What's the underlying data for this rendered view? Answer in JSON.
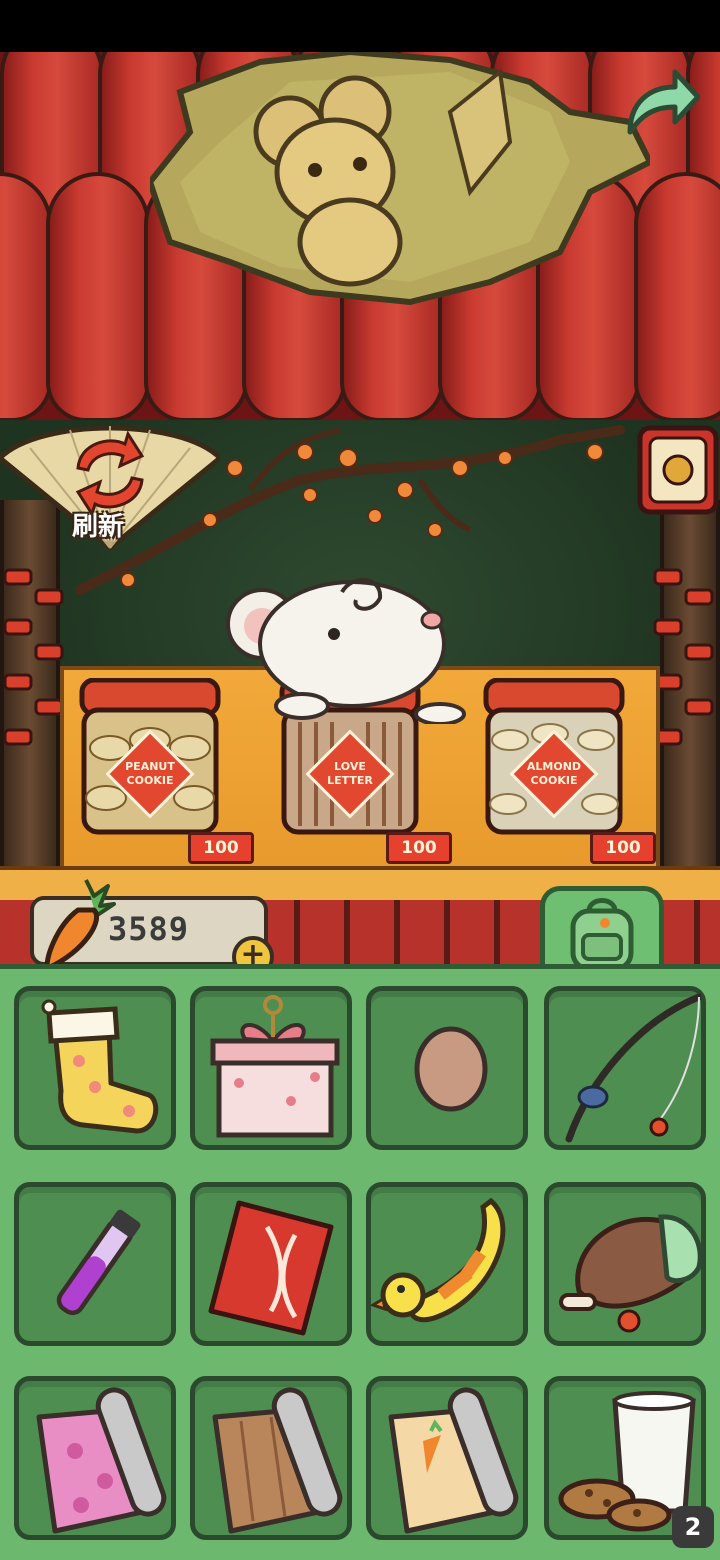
{
  "shop": {
    "refresh_label": "刷新",
    "goods": [
      {
        "name": "PEANUT COOKIE",
        "line1": "PEANUT",
        "line2": "COOKIE",
        "price": "100",
        "jar_color": "#d8c28a"
      },
      {
        "name": "LOVE LETTER",
        "line1": "LOVE",
        "line2": "LETTER",
        "price": "100",
        "jar_color": "#c9a889"
      },
      {
        "name": "ALMOND COOKIE",
        "line1": "ALMOND",
        "line2": "COOKIE",
        "price": "100",
        "jar_color": "#d9d2b8"
      }
    ]
  },
  "wallet": {
    "carrots": "3589",
    "add_label": "+"
  },
  "inventory": {
    "items": [
      {
        "icon": "stocking-icon"
      },
      {
        "icon": "gift-box-icon"
      },
      {
        "icon": "egg-icon"
      },
      {
        "icon": "fishing-rod-icon"
      },
      {
        "icon": "potion-vial-icon"
      },
      {
        "icon": "red-envelope-icon"
      },
      {
        "icon": "duck-swim-ring-icon"
      },
      {
        "icon": "drumstick-icon"
      },
      {
        "icon": "pink-wallpaper-roll-icon"
      },
      {
        "icon": "wood-wallpaper-roll-icon"
      },
      {
        "icon": "carrot-wallpaper-roll-icon"
      },
      {
        "icon": "milk-cookies-icon"
      }
    ],
    "badge_count": "2"
  },
  "colors": {
    "inventory_bg": "#6db86f",
    "slot_bg": "#4e8e51",
    "roof_red": "#c93a30",
    "counter_orange": "#f2a93a"
  }
}
